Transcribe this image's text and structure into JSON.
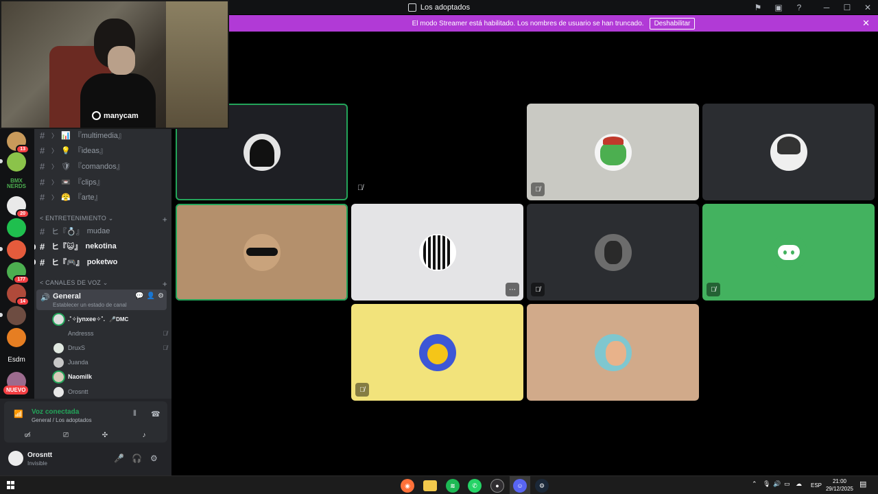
{
  "titlebar": {
    "title": "Los adoptados",
    "icons": [
      "inbox-icon",
      "window-icon",
      "help-icon",
      "minimize-icon",
      "maximize-icon",
      "close-icon"
    ]
  },
  "banner": {
    "message": "El modo Streamer está habilitado. Los nombres de usuario se han truncado.",
    "button": "Deshabilitar",
    "color": "#b13ad6"
  },
  "webcam": {
    "watermark": "manycam"
  },
  "servers": {
    "items": [
      {
        "name": "server-1",
        "badge": "13",
        "color": "#c89a5b"
      },
      {
        "name": "server-2",
        "badge": "",
        "color": "#8bc34a"
      },
      {
        "name": "server-bmx",
        "text": "BMX NERDS",
        "badge": "",
        "color": "#111214"
      },
      {
        "name": "server-4",
        "badge": "20",
        "color": "#e9e9e9"
      },
      {
        "name": "server-5",
        "badge": "",
        "color": "#1fbf4e"
      },
      {
        "name": "server-6",
        "badge": "",
        "color": "#e55b3c"
      },
      {
        "name": "server-7",
        "badge": "177",
        "color": "#4caf50"
      },
      {
        "name": "server-8",
        "badge": "14",
        "color": "#b04a3a"
      },
      {
        "name": "server-9",
        "badge": "",
        "color": "#6d4c41"
      },
      {
        "name": "server-10",
        "badge": "",
        "color": "#e67e22"
      },
      {
        "name": "server-esdm",
        "text": "Esdm",
        "badge": "",
        "color": "#111214"
      },
      {
        "name": "server-12",
        "badge": "",
        "color": "#9c6b8e"
      }
    ],
    "new_label": "NUEVO"
  },
  "channels": {
    "text_top": [
      {
        "label": "『multimedia』",
        "emoji": "📊"
      },
      {
        "label": "『ideas』",
        "emoji": "💡"
      },
      {
        "label": "『comandos』",
        "emoji": "🛡"
      },
      {
        "label": "『clips』",
        "emoji": "📼"
      },
      {
        "label": "『arte』",
        "emoji": "😤"
      }
    ],
    "cat_entertainment": "ENTRETENIMIENTO",
    "entertainment": [
      {
        "label": "mudae",
        "prefix": "ヒ『💍』",
        "bold": false
      },
      {
        "label": "nekotina",
        "prefix": "ヒ『😺』",
        "bold": true
      },
      {
        "label": "poketwo",
        "prefix": "ヒ『🎮』",
        "bold": true
      }
    ],
    "cat_voice": "CANALES DE VOZ",
    "voice_channel": {
      "name": "General",
      "status": "Establecer un estado de canal"
    },
    "voice_users": [
      {
        "name": ".˚✧jynxee✧˚.",
        "tag": "🎤DMC",
        "speaking": true,
        "bold": true,
        "muted": false
      },
      {
        "name": "Andresss",
        "tag": "",
        "speaking": false,
        "bold": false,
        "muted": true
      },
      {
        "name": "DruxS",
        "tag": "",
        "speaking": false,
        "bold": false,
        "muted": true
      },
      {
        "name": "Juanda",
        "tag": "",
        "speaking": false,
        "bold": false,
        "muted": false
      },
      {
        "name": "Naomilk",
        "tag": "",
        "speaking": true,
        "bold": true,
        "muted": false
      },
      {
        "name": "Orosntt",
        "tag": "",
        "speaking": false,
        "bold": false,
        "muted": false
      }
    ]
  },
  "voice_panel": {
    "status": "Voz conectada",
    "location": "General / Los adoptados",
    "buttons": [
      "camera-off-icon",
      "screenshare-icon",
      "activities-icon",
      "soundboard-icon"
    ]
  },
  "user": {
    "name": "Orosntt",
    "status": "Invisible"
  },
  "tiles": [
    {
      "name": "tile-crow",
      "bg": "#1e1f24",
      "avatar": "#e4e4e4",
      "speaking": true,
      "muted": false,
      "more": false
    },
    {
      "name": "tile-green-hat",
      "bg": "#c9c9c3",
      "avatar": "#f5f5f5",
      "speaking": false,
      "muted": true,
      "more": false
    },
    {
      "name": "tile-sketch",
      "bg": "#2b2d31",
      "avatar": "#efefef",
      "speaking": false,
      "muted": false,
      "more": false
    },
    {
      "name": "tile-sunglasses",
      "bg": "#b4906c",
      "avatar": "#c9a37c",
      "speaking": true,
      "muted": false,
      "more": false
    },
    {
      "name": "tile-mono",
      "bg": "#e4e4e6",
      "avatar": "#ffffff",
      "speaking": false,
      "muted": false,
      "more": true
    },
    {
      "name": "tile-girl",
      "bg": "#2b2d31",
      "avatar": "#6c6c6c",
      "speaking": false,
      "muted": true,
      "more": false
    },
    {
      "name": "tile-discord",
      "bg": "#43b25f",
      "avatar": "#43b25f",
      "speaking": false,
      "muted": true,
      "more": false
    },
    {
      "name": "tile-pikachu",
      "bg": "#f2e37b",
      "avatar": "#3d57d6",
      "speaking": false,
      "muted": true,
      "more": false
    },
    {
      "name": "tile-cartoon",
      "bg": "#d1aa8a",
      "avatar": "#7fc7cf",
      "speaking": false,
      "muted": false,
      "more": false
    }
  ],
  "taskbar": {
    "apps": [
      {
        "name": "firefox-icon",
        "color": "#ff7139"
      },
      {
        "name": "folder-icon",
        "color": "#f2c94c"
      },
      {
        "name": "spotify-icon",
        "color": "#1db954"
      },
      {
        "name": "whatsapp-icon",
        "color": "#25d366"
      },
      {
        "name": "obs-icon",
        "color": "#302e31"
      },
      {
        "name": "discord-icon",
        "color": "#5865f2"
      },
      {
        "name": "steam-icon",
        "color": "#1b2838"
      }
    ],
    "lang": "ESP",
    "time": "21:00",
    "date": "29/12/2025"
  }
}
